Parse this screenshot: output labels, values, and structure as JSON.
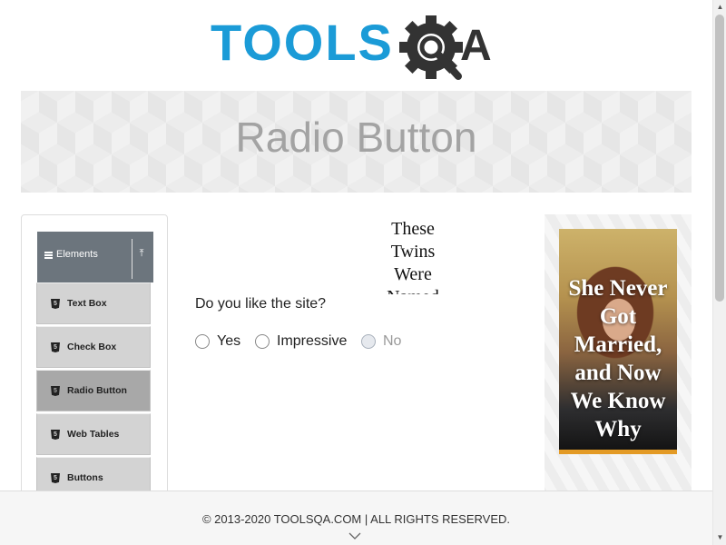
{
  "header": {
    "logo_text_left": "TOOLS",
    "logo_text_right": "QA",
    "logo_colors": {
      "tools": "#1b9bd7",
      "qa": "#333333"
    }
  },
  "banner": {
    "title": "Radio Button"
  },
  "sidebar": {
    "group_label": "Elements",
    "items": [
      {
        "label": "Text Box",
        "active": false
      },
      {
        "label": "Check Box",
        "active": false
      },
      {
        "label": "Radio Button",
        "active": true
      },
      {
        "label": "Web Tables",
        "active": false
      },
      {
        "label": "Buttons",
        "active": false
      }
    ]
  },
  "inline_ad": {
    "text": "These Twins Were Named"
  },
  "main": {
    "question": "Do you like the site?",
    "options": [
      {
        "label": "Yes",
        "disabled": false
      },
      {
        "label": "Impressive",
        "disabled": false
      },
      {
        "label": "No",
        "disabled": true
      }
    ]
  },
  "right_ad": {
    "headline": "She Never Got Married, and Now We Know Why",
    "accent_color": "#e39a25"
  },
  "footer": {
    "text": "© 2013-2020 TOOLSQA.COM | ALL RIGHTS RESERVED."
  }
}
